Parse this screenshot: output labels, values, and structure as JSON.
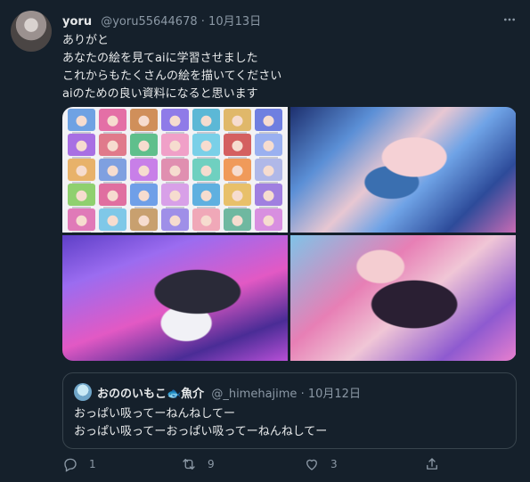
{
  "tweet": {
    "author_name": "yoru",
    "author_handle": "@yoru55644678",
    "separator": "·",
    "date": "10月13日",
    "text_lines": [
      "ありがと",
      "あなたの絵を見てaiに学習させました",
      "これからもたくさんの絵を描いてください",
      "aiのための良い資料になると思います"
    ]
  },
  "media": {
    "thumbnail_colors": [
      "#6fa2e3",
      "#e46fa6",
      "#d08f5a",
      "#8f7be8",
      "#5cb8d6",
      "#e0b86a",
      "#6f7fe0",
      "#a86fe3",
      "#e07a8b",
      "#5fbf8c",
      "#f0a0c8",
      "#7ad0e8",
      "#d46060",
      "#9ab0f0",
      "#e8b26a",
      "#7fa0e0",
      "#c87fe8",
      "#e08fb0",
      "#6fd0c0",
      "#f09a5a",
      "#b0b8e8",
      "#8fd06f",
      "#e06fa0",
      "#6f9fe8",
      "#d8a0e8",
      "#5fb0e0",
      "#e8c06a",
      "#a07fe0",
      "#e07ab8",
      "#7fc8e8",
      "#c8a06f",
      "#9f8fe8",
      "#f0a8b8",
      "#6fb8a0",
      "#d88fe0"
    ]
  },
  "quote": {
    "author_name": "おののいもこ🐟魚介",
    "author_handle": "@_himehajime",
    "separator": "·",
    "date": "10月12日",
    "text_lines": [
      "おっぱい吸ってーねんねしてー",
      "おっぱい吸ってーおっぱい吸ってーねんねしてー"
    ]
  },
  "actions": {
    "reply_count": "1",
    "retweet_count": "9",
    "like_count": "3"
  },
  "icons": {
    "more": "more-icon",
    "reply": "reply-icon",
    "retweet": "retweet-icon",
    "like": "like-icon",
    "share": "share-icon"
  }
}
